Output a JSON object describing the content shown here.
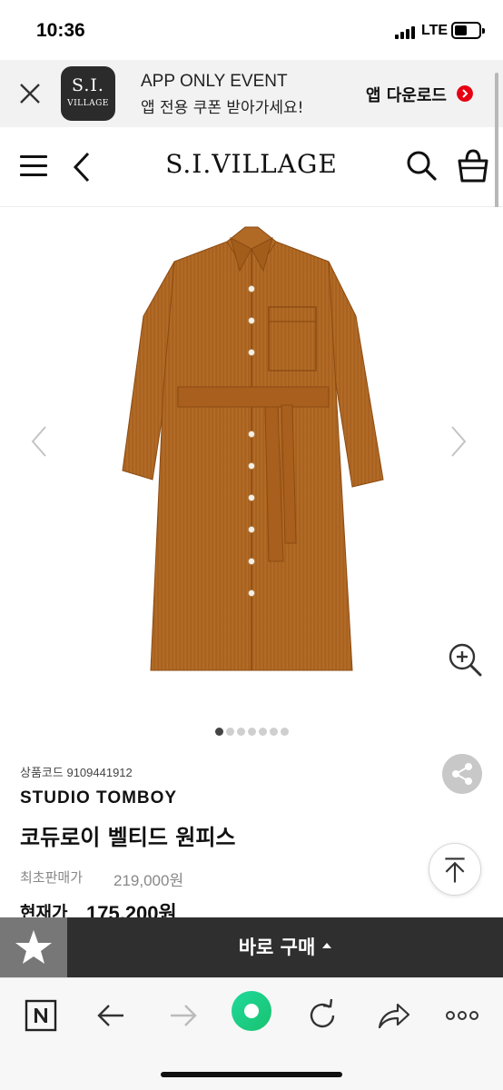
{
  "status_bar": {
    "time": "10:36",
    "network": "LTE"
  },
  "app_banner": {
    "logo_line1": "S.I.",
    "logo_line2": "VILLAGE",
    "title": "APP ONLY EVENT",
    "subtitle": "앱 전용 쿠폰 받아가세요!",
    "download_label": "앱 다운로드",
    "accent_color": "#e60012"
  },
  "header": {
    "logo": "S.I.VILLAGE"
  },
  "gallery": {
    "image_subject": "camel corduroy belted shirt dress",
    "slide_count": 7,
    "active_slide": 1
  },
  "product": {
    "code_label": "상품코드",
    "code": "9109441912",
    "brand": "STUDIO TOMBOY",
    "name": "코듀로이 벨티드 원피스",
    "original_price_label": "최초판매가",
    "original_price": "219,000원",
    "current_price_label": "현재가",
    "current_price": "175,200원"
  },
  "buy_bar": {
    "buy_label": "바로 구매",
    "favorite_icon": "star-icon"
  },
  "browser_toolbar": {
    "items": [
      "naver-n-icon",
      "back-arrow-icon",
      "forward-arrow-icon",
      "green-home-icon",
      "reload-icon",
      "share-arrow-icon",
      "more-icon"
    ]
  }
}
